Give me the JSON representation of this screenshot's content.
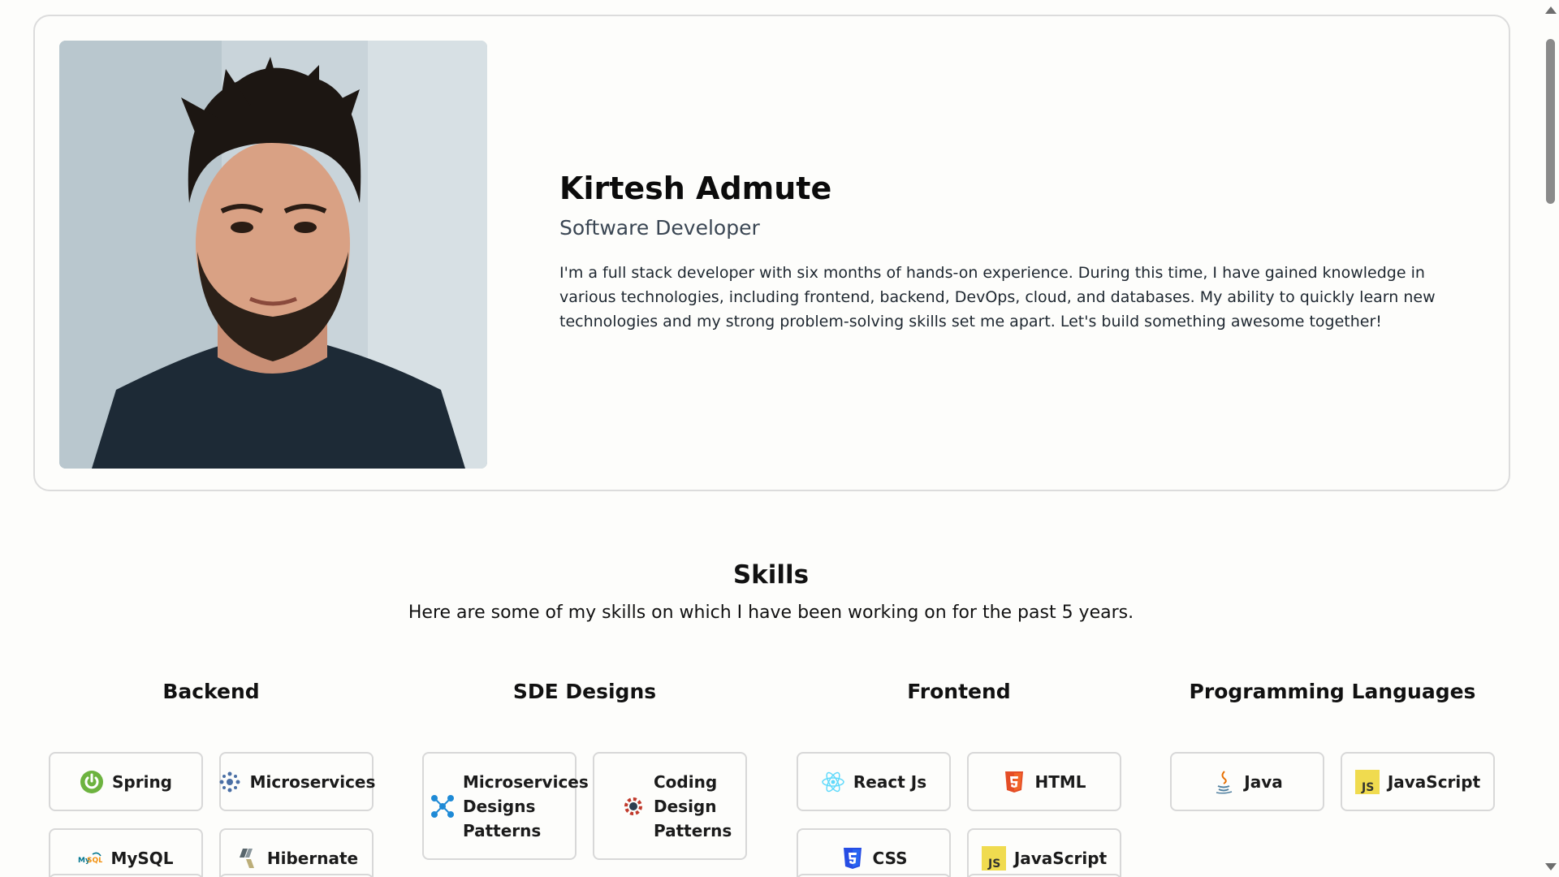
{
  "hero": {
    "name": "Kirtesh Admute",
    "role": "Software Developer",
    "bio": "I'm a full stack developer with six months of hands-on experience. During this time, I have gained knowledge in various technologies, including frontend, backend, DevOps, cloud, and databases. My ability to quickly learn new technologies and my strong problem-solving skills set me apart. Let's build something awesome together!"
  },
  "skills": {
    "title": "Skills",
    "subtitle": "Here are some of my skills on which I have been working on for the past 5 years.",
    "columns": [
      {
        "title": "Backend",
        "items": [
          {
            "label": "Spring",
            "icon": "spring-icon"
          },
          {
            "label": "Microservices",
            "icon": "microservices-icon"
          },
          {
            "label": "MySQL",
            "icon": "mysql-icon"
          },
          {
            "label": "Hibernate",
            "icon": "hibernate-icon"
          }
        ]
      },
      {
        "title": "SDE Designs",
        "items": [
          {
            "label": "Microservices Designs Patterns",
            "icon": "microservices-patterns-icon"
          },
          {
            "label": "Coding Design Patterns",
            "icon": "design-patterns-icon"
          }
        ]
      },
      {
        "title": "Frontend",
        "items": [
          {
            "label": "React Js",
            "icon": "react-icon"
          },
          {
            "label": "HTML",
            "icon": "html5-icon"
          },
          {
            "label": "CSS",
            "icon": "css3-icon"
          },
          {
            "label": "JavaScript",
            "icon": "javascript-icon"
          }
        ]
      },
      {
        "title": "Programming Languages",
        "items": [
          {
            "label": "Java",
            "icon": "java-icon"
          },
          {
            "label": "JavaScript",
            "icon": "javascript-icon"
          }
        ]
      }
    ]
  },
  "colors": {
    "background": "#fdfdfb",
    "border": "#d8d8d8",
    "text": "#111111",
    "role_text": "#3a4653",
    "spring_green": "#6db33f",
    "react_cyan": "#61dafb",
    "html_orange": "#e44d26",
    "css_blue": "#264de4",
    "js_yellow": "#f0db4f"
  }
}
